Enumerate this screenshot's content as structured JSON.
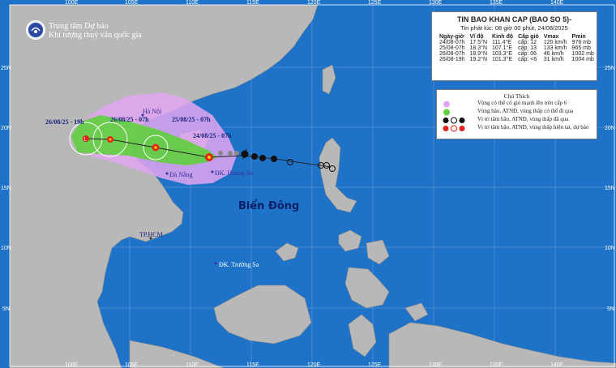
{
  "agency": {
    "line1": "Trung tâm Dự báo",
    "line2": "Khí tượng thuỷ văn quốc gia"
  },
  "bulletin": {
    "title": "TIN BAO KHAN CAP (BAO SO 5)-",
    "issued": "Tin phát lúc: 08 giờ 00 phút, 24/08/2025",
    "headers": [
      "Ngày-giờ",
      "Vĩ độ",
      "Kinh độ",
      "Cấp gió",
      "Vmax",
      "Pmin"
    ],
    "rows": [
      [
        "24/08-07h",
        "17.5°N",
        "111.4°E",
        "cấp: 12",
        "120 km/h",
        "976 mb"
      ],
      [
        "25/08-07h",
        "18.3°N",
        "107.1°E",
        "cấp: 13",
        "133 km/h",
        "965 mb"
      ],
      [
        "26/08-07h",
        "18.9°N",
        "103.3°E",
        "cấp: 06",
        "46 km/h",
        "1002 mb"
      ],
      [
        "26/08-19h",
        "19.2°N",
        "101.3°E",
        "cấp: <6",
        "31 km/h",
        "1004 mb"
      ]
    ]
  },
  "legend": {
    "title": "Chú Thích",
    "items": [
      "Vùng có thể có gió mạnh lên trên cấp 6",
      "Vùng bão, ATNĐ, vùng thấp có thể đi qua",
      "Vị trí tâm bão, ATNĐ, vùng thấp đã qua",
      "Vị trí tâm bão, ATNĐ, vùng thấp hiện tại, dự báo"
    ],
    "colors": {
      "wind_zone": "#e2a6f0",
      "track_zone": "#5fcf3c",
      "past": "#111111",
      "forecast": "#e2231a"
    }
  },
  "axes": {
    "lon_top": [
      "100E",
      "105E",
      "110E",
      "115E",
      "120E",
      "125E",
      "130E",
      "135E",
      "140E"
    ],
    "lon_bottom": [
      "100E",
      "105E",
      "110E",
      "115E",
      "120E",
      "125E",
      "130E",
      "135E",
      "140E"
    ],
    "lat_left": [
      "25N",
      "20N",
      "15N",
      "10N",
      "5N"
    ],
    "lat_right": [
      "25N",
      "20N",
      "15N",
      "10N",
      "5N"
    ]
  },
  "places": {
    "hanoi": "Hà Nội",
    "danang": "Đà Nẵng",
    "hoangsa": "ĐK. Hoàng Sa",
    "hcm": "TP.HCM",
    "truongsa": "ĐK. Trường Sa",
    "sea": "Biển Đông"
  },
  "time_labels": {
    "t1": "26/08/25 - 19h",
    "t2": "26/08/25 - 07h",
    "t3": "25/08/25 - 07h",
    "t4": "24/08/25 - 07h"
  }
}
